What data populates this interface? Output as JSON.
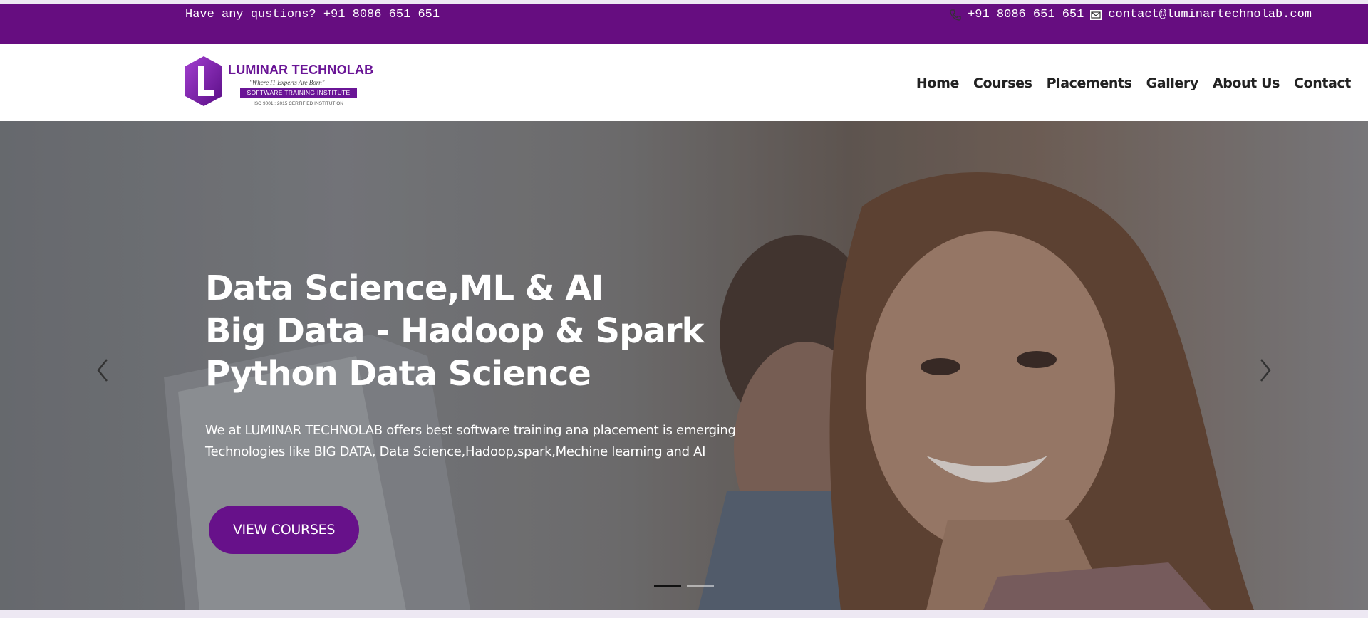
{
  "topbar": {
    "question": "Have any qustions? +91 8086 651 651",
    "phone": "+91 8086 651 651",
    "email": "contact@luminartechnolab.com",
    "phone_icon": "phone-icon",
    "email_icon": "envelope-icon",
    "background": "#660d80"
  },
  "logo": {
    "brand": "LUMINAR TECHNOLAB",
    "tagline": "\"Where IT Experts Are Born\"",
    "strip": "SOFTWARE TRAINING INSTITUTE",
    "iso": "ISO 9001 : 2015 CERTIFIED INSTITUTION",
    "letter": "L",
    "color": "#6a1596"
  },
  "nav": {
    "items": [
      "Home",
      "Courses",
      "Placements",
      "Gallery",
      "About Us",
      "Contact"
    ]
  },
  "hero": {
    "title_lines": [
      "Data Science,ML & AI",
      "Big Data - Hadoop & Spark",
      "Python Data Science"
    ],
    "description": "We at LUMINAR TECHNOLAB offers best software training ana placement is emerging Technologies like BIG DATA, Data Science,Hadoop,spark,Mechine learning and AI",
    "button": "VIEW COURSES",
    "button_color": "#67118a",
    "prev_icon": "chevron-left-icon",
    "next_icon": "chevron-right-icon",
    "slides_total": 2,
    "active_slide": 1
  }
}
